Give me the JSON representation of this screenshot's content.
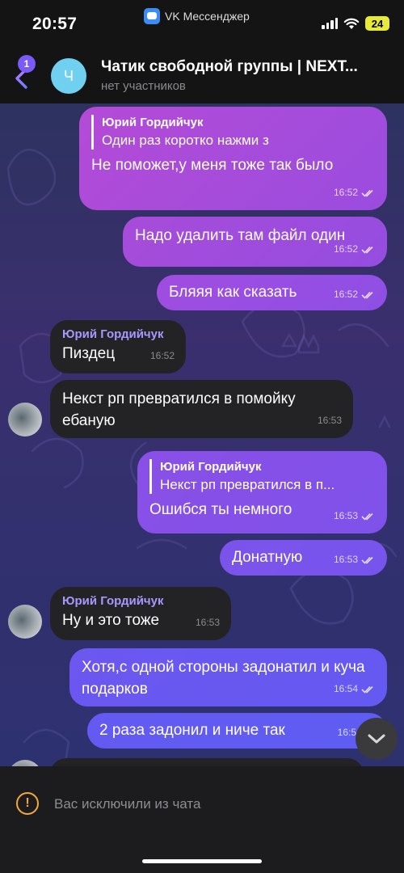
{
  "status_bar": {
    "time": "20:57",
    "app_name": "VK Мессенджер",
    "battery": "24"
  },
  "header": {
    "back_badge": "1",
    "avatar_letter": "Ч",
    "title": "Чатик свободной группы | NEXT...",
    "subtitle": "нет участников"
  },
  "messages": [
    {
      "quote_name": "Юрий Гордийчук",
      "quote_text": "Один раз коротко нажми з",
      "text": "Не поможет,у меня тоже так было",
      "time": "16:52"
    },
    {
      "text": "Надо удалить там файл один",
      "time": "16:52"
    },
    {
      "text": "Бляяя как сказать",
      "time": "16:52"
    },
    {
      "sender": "Юрий Гордийчук",
      "text": "Пиздец",
      "time": "16:52"
    },
    {
      "text": "Некст рп превратился в помойку ебаную",
      "time": "16:53"
    },
    {
      "quote_name": "Юрий Гордийчук",
      "quote_text": "Некст рп превратился в п...",
      "text": "Ошибся ты немного",
      "time": "16:53"
    },
    {
      "text": "Донатную",
      "time": "16:53"
    },
    {
      "sender": "Юрий Гордийчук",
      "text": "Ну и это тоже",
      "time": "16:53"
    },
    {
      "text": "Хотя,с одной стороны задонатил и куча подарков",
      "time": "16:54"
    },
    {
      "text": "2 раза задонил и ниче так",
      "time": "16:5"
    }
  ],
  "footer": {
    "notice": "Вас исключили из чата"
  },
  "colors": {
    "accent": "#7a5af8",
    "incoming_bubble": "#232325",
    "warning": "#f2a93b",
    "outgoing_top": "#b44bd6",
    "outgoing_bottom": "#6a4ff0"
  }
}
